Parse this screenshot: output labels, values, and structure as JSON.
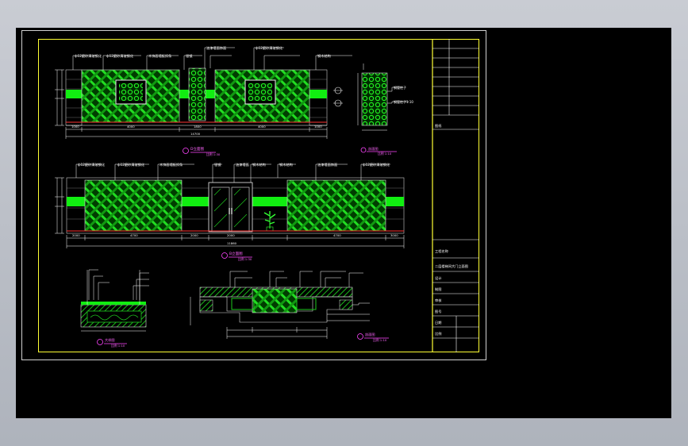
{
  "drawing": {
    "elevation_a": {
      "title": "D立面图",
      "scale": "比例 1:30",
      "annotations": [
        "ф12磨砂清玻钢化",
        "ф12磨砂清玻钢化",
        "木饰面墙板扣条",
        "银镜",
        "油漆墙面饰面",
        "ф12磨砂清玻钢化",
        "钢木结构"
      ],
      "dimensions": [
        "1000",
        "4000",
        "1800",
        "4000",
        "1000",
        "14700"
      ]
    },
    "detail_a": {
      "title": "剖面图",
      "scale": "比例 1:10",
      "annotations": [
        "钢管柱子",
        "钢管柱子1:10"
      ]
    },
    "elevation_b": {
      "title": "B立面图",
      "scale": "比例 1:30",
      "annotations": [
        "ф12磨砂清玻钢化",
        "ф12磨砂清玻钢化",
        "木饰面墙板扣条",
        "银镜",
        "油漆墙面",
        "钢木结构",
        "钢木结构",
        "油漆墙面饰面",
        "ф12磨砂清玻钢化"
      ],
      "dimensions": [
        "2000",
        "4700",
        "2000",
        "2000",
        "4700",
        "3000",
        "11860"
      ]
    },
    "section_a": {
      "title": "大样图",
      "scale": "比例 1:10"
    },
    "section_b": {
      "title": "剖面图",
      "scale": "比例 1:10"
    },
    "title_block": {
      "rows": [
        "工程名称",
        "二层楼梯间大门立面图",
        "设计",
        "制图",
        "审核",
        "图号",
        "日期",
        "比例"
      ]
    }
  }
}
